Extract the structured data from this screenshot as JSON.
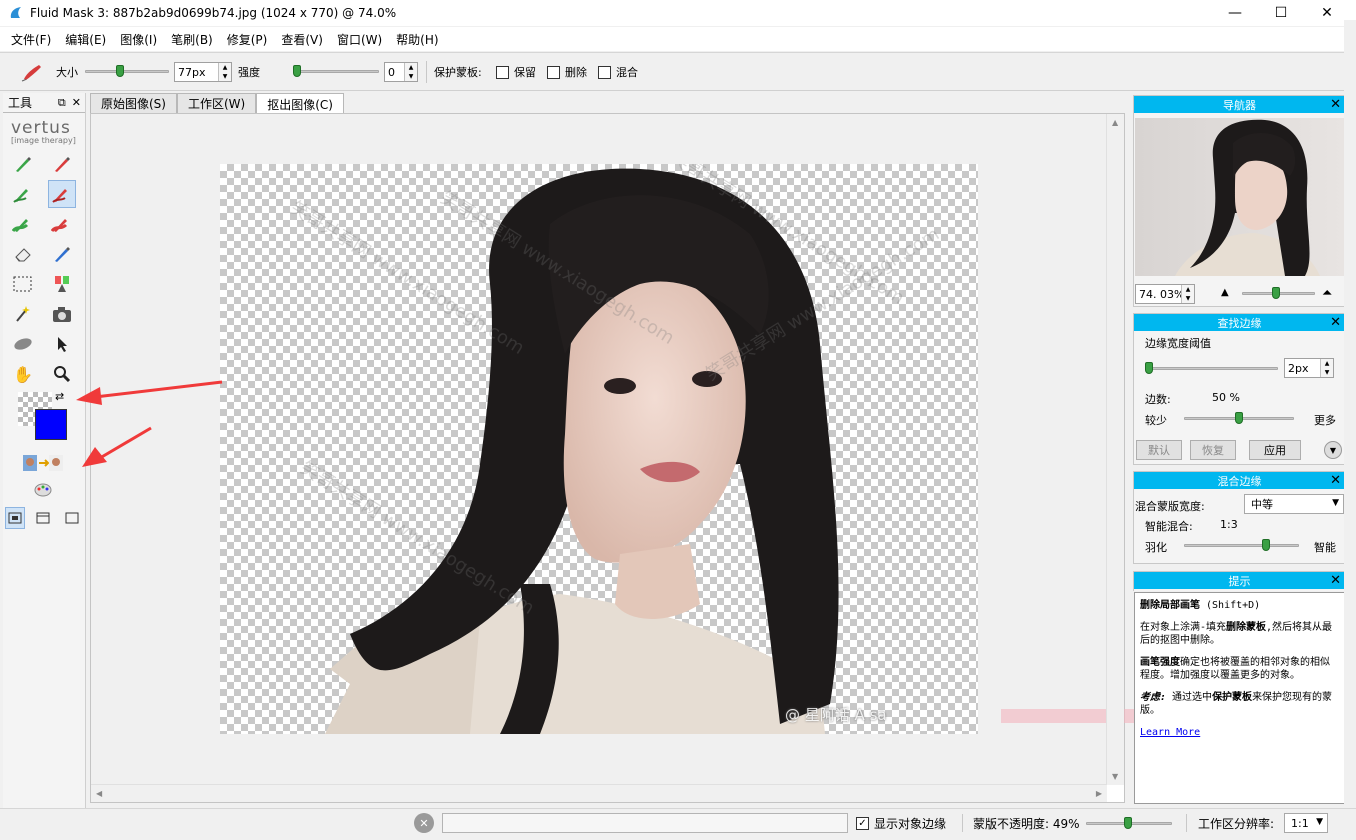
{
  "window": {
    "title": "Fluid Mask 3: 887b2ab9d0699b74.jpg (1024 x 770) @ 74.0%",
    "minimize": "—",
    "maximize": "☐",
    "close": "✕"
  },
  "menu": [
    {
      "label": "文件(F)"
    },
    {
      "label": "编辑(E)"
    },
    {
      "label": "图像(I)"
    },
    {
      "label": "笔刷(B)"
    },
    {
      "label": "修复(P)"
    },
    {
      "label": "查看(V)"
    },
    {
      "label": "窗口(W)"
    },
    {
      "label": "帮助(H)"
    }
  ],
  "toolbar": {
    "size_label": "大小",
    "size_value": "77px",
    "strength_label": "强度",
    "strength_value": "0",
    "protect_label": "保护蒙板:",
    "keep_label": "保留",
    "delete_label": "删除",
    "blend_label": "混合"
  },
  "tool_panel": {
    "title": "工具",
    "logo_big": "vertus",
    "logo_small": "[image therapy]"
  },
  "tabs": [
    {
      "label": "原始图像(S)",
      "active": false
    },
    {
      "label": "工作区(W)",
      "active": false
    },
    {
      "label": "抠出图像(C)",
      "active": true
    }
  ],
  "watermarks": [
    "笑哥共享网 www.xiaogegh.com",
    "笑哥共享网 www.xiaogegh.com",
    "笑哥共享网 www.xiaogegh.com",
    "笑哥共享网 www.xiaogegh.com",
    "笑哥共享网 www.xiaogegh.com"
  ],
  "photo_credit": "@ 星阿话 A  sa",
  "navigator": {
    "title": "导航器",
    "zoom_value": "74. 03%"
  },
  "find_edge": {
    "title": "查找边缘",
    "threshold_label": "边缘宽度阈值",
    "threshold_value": "2px",
    "edge_count_label": "边数:",
    "edge_count_value": "50 %",
    "less_label": "较少",
    "more_label": "更多",
    "default_btn": "默认",
    "restore_btn": "恢复",
    "apply_btn": "应用"
  },
  "blend_edge": {
    "title": "混合边缘",
    "mask_width_label": "混合蒙版宽度:",
    "mask_width_value": "中等",
    "smart_blend_label": "智能混合:",
    "smart_blend_value": "1:3",
    "feather_label": "羽化",
    "smart_label": "智能"
  },
  "hints": {
    "title": "提示",
    "heading": "删除局部画笔",
    "shortcut": " (Shift+D)",
    "p1_a": "在对象上涂满-填充",
    "p1_b": "删除蒙板",
    "p1_c": ",然后将其从最后的抠图中删除。",
    "p2_a": "画笔强度",
    "p2_b": "确定也将被覆盖的相邻对象的相似程度。增加强度以覆盖更多的对象。",
    "p3_a": "考虑:",
    "p3_b": " 通过选中",
    "p3_c": "保护蒙板",
    "p3_d": "来保护您现有的蒙版。",
    "link": "Learn More"
  },
  "status": {
    "show_edges_label": "显示对象边缘",
    "mask_opacity_label": "蒙版不透明度: 49%",
    "workspace_res_label": "工作区分辨率:",
    "workspace_res_value": "1:1"
  },
  "colors": {
    "accent": "#00b7ef",
    "swatch_bg": "#0000ff"
  }
}
